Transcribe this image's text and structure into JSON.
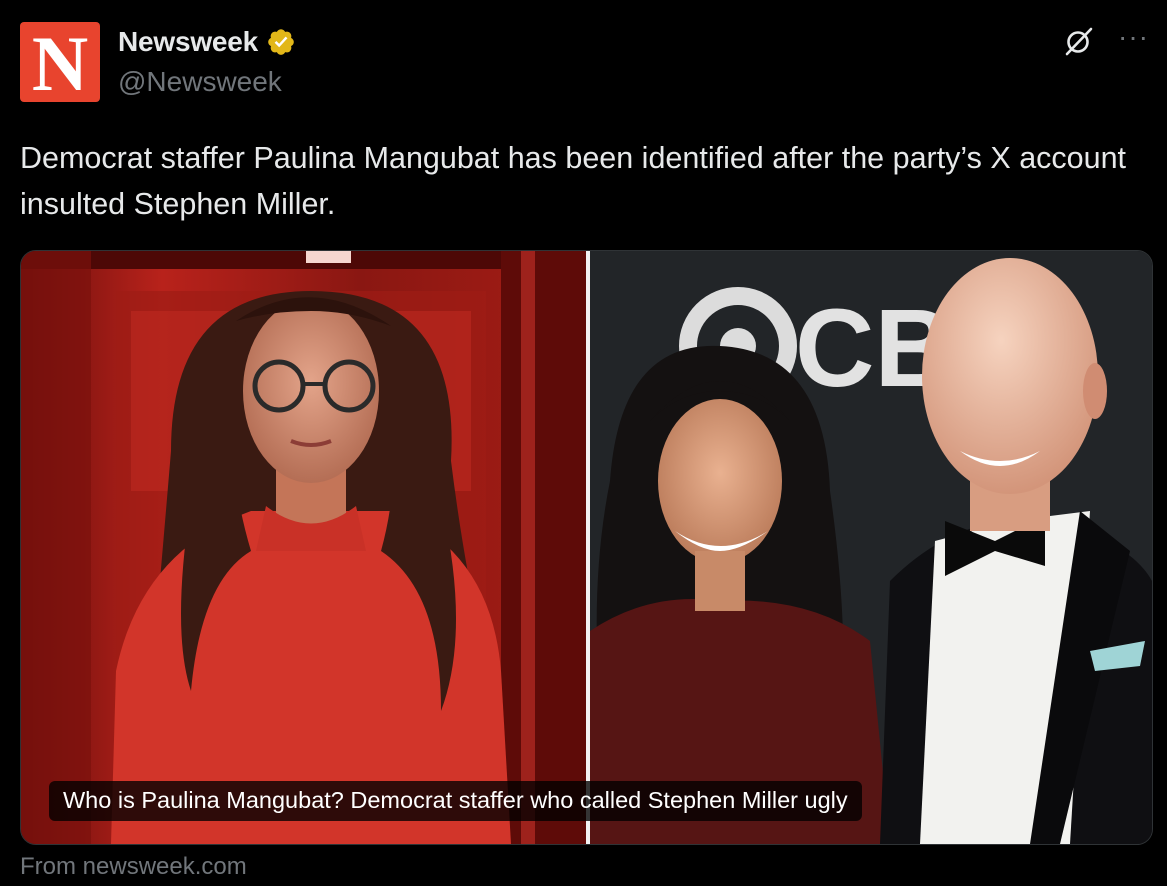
{
  "account": {
    "avatar_letter": "N",
    "display_name": "Newsweek",
    "handle": "@Newsweek",
    "verified_badge_color": "#e2b719",
    "avatar_color": "#e8442e"
  },
  "header_icons": {
    "grok": "grok-icon",
    "more": "···"
  },
  "post": {
    "text": "Democrat staffer Paulina Mangubat has been identified after the party’s X account insulted Stephen Miller."
  },
  "card": {
    "caption": "Who is Paulina Mangubat? Democrat staffer who called Stephen Miller ugly",
    "backdrop_logo_text": "CB",
    "source": "From newsweek.com"
  },
  "colors": {
    "background": "#000000",
    "text_primary": "#e7e9ea",
    "text_secondary": "#71767b",
    "border": "#2f3336"
  }
}
